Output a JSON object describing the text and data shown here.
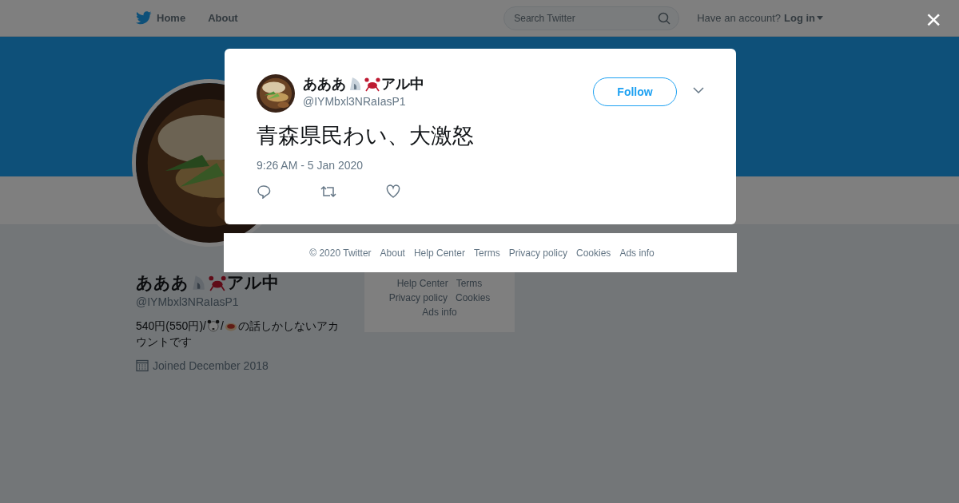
{
  "topbar": {
    "nav_items": [
      {
        "label": "Home",
        "kind": "home"
      },
      {
        "label": "About",
        "kind": "plain"
      }
    ],
    "search": {
      "placeholder": "Search Twitter"
    },
    "account_prompt": "Have an account?",
    "login": "Log in"
  },
  "profile": {
    "name": [
      {
        "kind": "text",
        "text": "あああ"
      },
      {
        "kind": "shell"
      },
      {
        "kind": "crab"
      },
      {
        "kind": "text",
        "text": "アル中"
      }
    ],
    "handle": "@IYMbxl3NRaIasP1",
    "bio": [
      {
        "kind": "text",
        "text": "540円(550円)/"
      },
      {
        "kind": "panda"
      },
      {
        "kind": "text",
        "text": "/"
      },
      {
        "kind": "dish"
      },
      {
        "kind": "text",
        "text": "の話しかしないアカ"
      },
      {
        "kind": "text",
        "text": "ウントです"
      }
    ],
    "joined": "Joined December 2018"
  },
  "sidebar_footer": {
    "links": [
      "Help Center",
      "Terms",
      "Privacy policy",
      "Cookies",
      "Ads info"
    ]
  },
  "close": "×",
  "tweet": {
    "name": [
      {
        "kind": "text",
        "text": "あああ"
      },
      {
        "kind": "shell"
      },
      {
        "kind": "crab"
      },
      {
        "kind": "text",
        "text": "アル中"
      }
    ],
    "handle": "@IYMbxl3NRaIasP1",
    "follow": "Follow",
    "text": "青森県民わい、大激怒",
    "time": "9:26 AM - 5 Jan 2020"
  },
  "footer": {
    "links": [
      "© 2020 Twitter",
      "About",
      "Help Center",
      "Terms",
      "Privacy policy",
      "Cookies",
      "Ads info"
    ]
  }
}
